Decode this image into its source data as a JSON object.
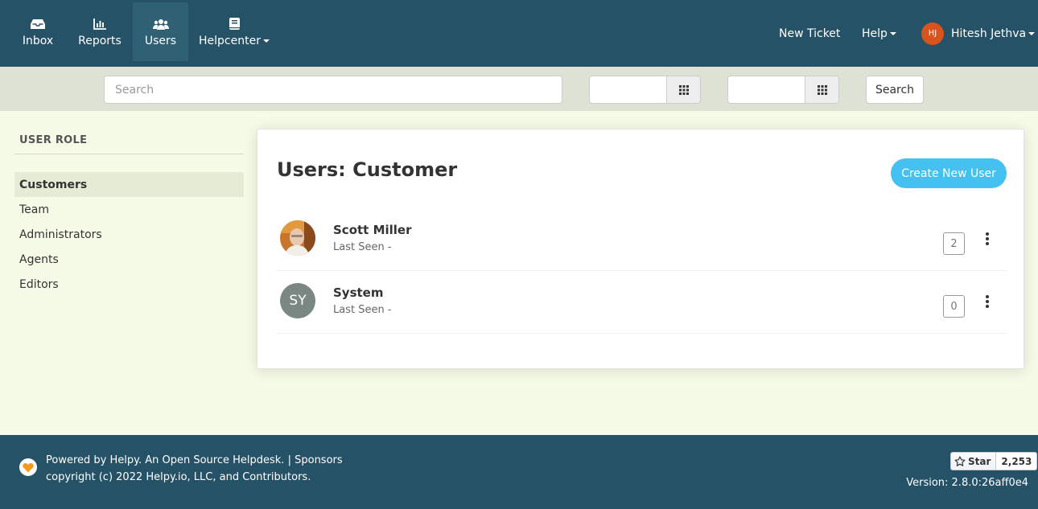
{
  "nav": {
    "inbox": "Inbox",
    "reports": "Reports",
    "users": "Users",
    "helpcenter": "Helpcenter",
    "new_ticket": "New Ticket",
    "help": "Help",
    "user_initials": "HJ",
    "user_name": "Hitesh Jethva"
  },
  "search": {
    "placeholder": "Search",
    "button": "Search"
  },
  "sidebar": {
    "heading": "USER ROLE",
    "items": [
      {
        "label": "Customers",
        "active": true
      },
      {
        "label": "Team"
      },
      {
        "label": "Administrators"
      },
      {
        "label": "Agents"
      },
      {
        "label": "Editors"
      }
    ]
  },
  "main": {
    "title": "Users: Customer",
    "create_button": "Create New User",
    "users": [
      {
        "name": "Scott Miller",
        "last_seen": "Last Seen -",
        "count": "2"
      },
      {
        "name": "System",
        "initials": "SY",
        "last_seen": "Last Seen -",
        "count": "0"
      }
    ]
  },
  "footer": {
    "powered_by": "Powered by Helpy. An Open Source Helpdesk.",
    "separator": " | ",
    "sponsors": "Sponsors",
    "copyright": "copyright (c) 2022 Helpy.io, LLC, and Contributors.",
    "star_label": "Star",
    "star_count": "2,253",
    "version": "Version: 2.8.0:26aff0e4"
  },
  "colors": {
    "nav_bg": "#255266",
    "accent": "#45c1f1",
    "avatar_badge": "#d9531e",
    "page_bg": "#f5fbe6"
  }
}
